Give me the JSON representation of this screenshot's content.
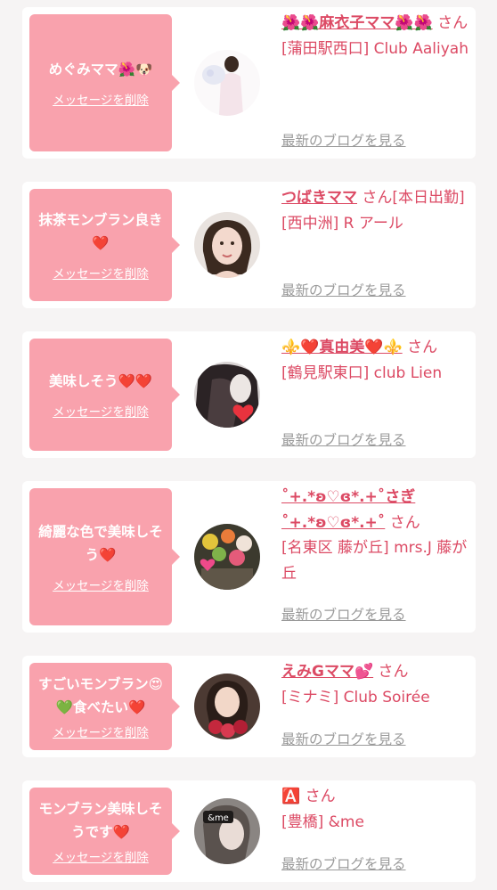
{
  "delete_label": "メッセージを削除",
  "blog_label": "最新のブログを見る",
  "san_label": "さん",
  "colors": {
    "accent": "#dc4a64",
    "bubble": "#f9a2ad",
    "muted": "#9a9a9a"
  },
  "items": [
    {
      "message": "めぐみママ🌺🐶",
      "name": "🌺🌺麻衣子ママ🌺🌺",
      "extra": "",
      "shop": "[蒲田駅西口] Club Aaliyah",
      "avatar": "photo-woman-white-dress"
    },
    {
      "message": "抹茶モンブラン良き❤️",
      "name": "つばきママ",
      "extra": "[本日出勤]",
      "shop": "[西中洲] R アール",
      "avatar": "photo-woman-portrait"
    },
    {
      "message": "美味しそう❤️❤️",
      "name": "⚜️❤️真由美❤️⚜️",
      "extra": "",
      "shop": "[鶴見駅東口] club Lien",
      "avatar": "photo-dark-hair"
    },
    {
      "message": "綺麗な色で美味しそう❤️",
      "name": "˚+.*ʚ♡ɞ*.+˚さぎ˚+.*ʚ♡ɞ*.+˚",
      "extra": "",
      "shop": "[名東区 藤が丘] mrs.J 藤が丘",
      "avatar": "photo-flowers"
    },
    {
      "message": "すごいモンブラン😍💚食べたい❤️",
      "name": "えみGママ💕",
      "extra": "",
      "shop": "[ミナミ] Club Soirée",
      "avatar": "photo-woman-roses"
    },
    {
      "message": "モンブラン美味しそうです❤️",
      "name": "🅰️",
      "extra": "",
      "shop": "[豊橋] &me",
      "avatar": "photo-andme-logo"
    }
  ]
}
